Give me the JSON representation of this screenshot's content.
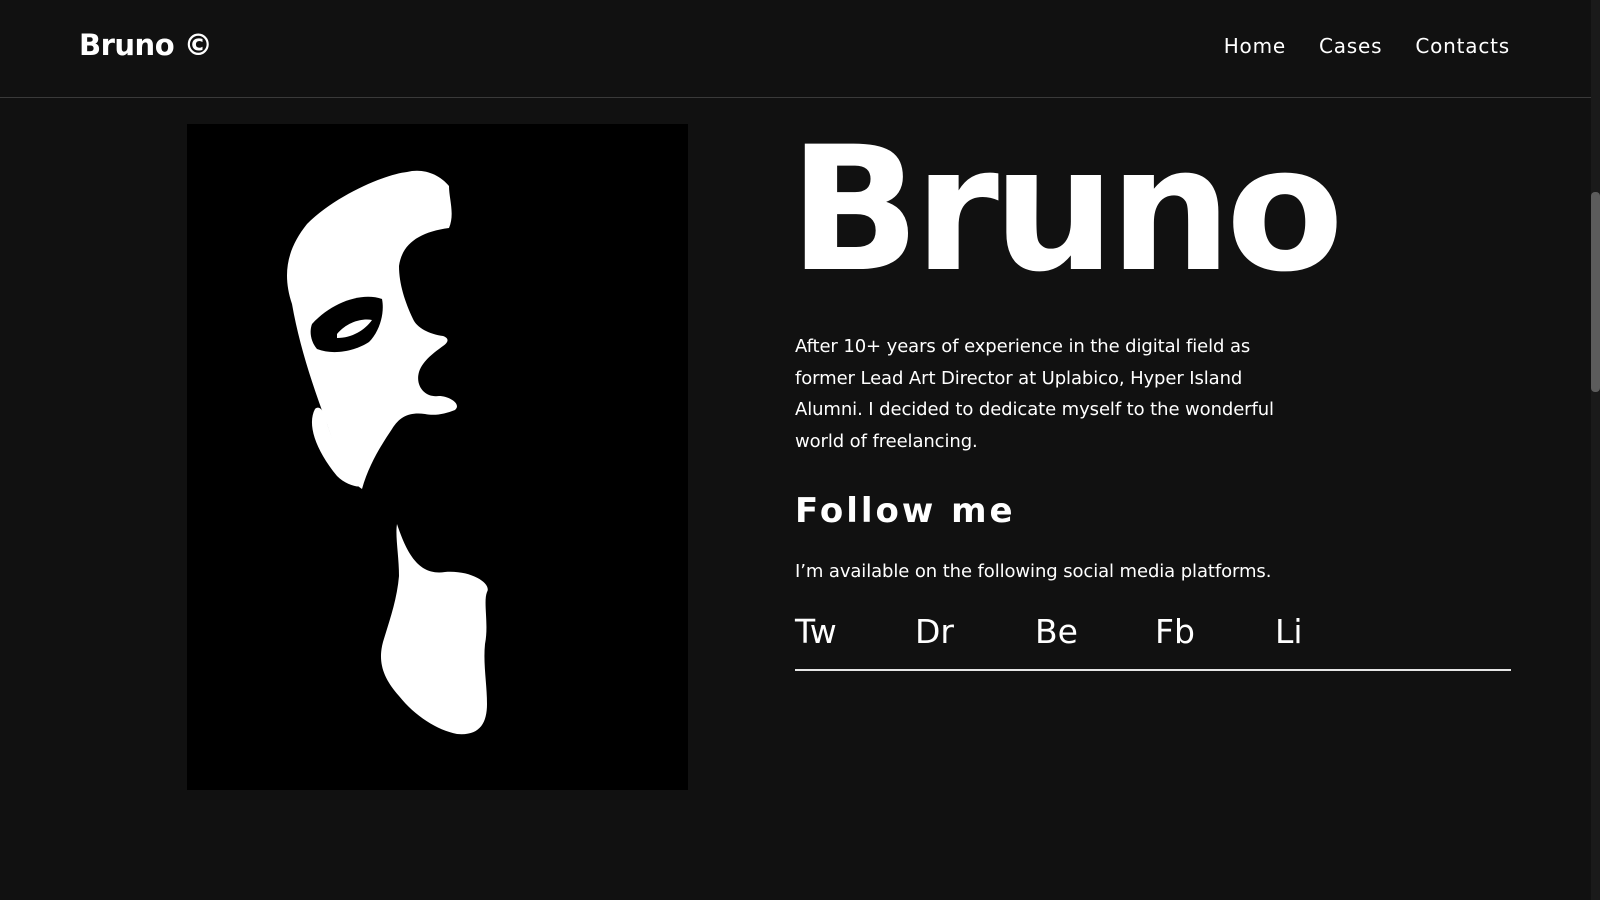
{
  "header": {
    "brand": "Bruno ©",
    "nav": [
      {
        "label": "Home"
      },
      {
        "label": "Cases"
      },
      {
        "label": "Contacts"
      }
    ]
  },
  "portrait": {
    "icon": "portrait-image"
  },
  "main": {
    "hero_title": "Bruno",
    "bio": "After 10+ years of experience in the digital field as former Lead Art Director at Uplabico, Hyper Island Alumni. I decided to dedicate myself to the wonderful world of freelancing.",
    "follow_heading": "Follow me",
    "available_text": "I’m available on the following social media platforms.",
    "social": [
      {
        "label": "Tw"
      },
      {
        "label": "Dr"
      },
      {
        "label": "Be"
      },
      {
        "label": "Fb"
      },
      {
        "label": "Li"
      }
    ]
  },
  "colors": {
    "background": "#111111",
    "text": "#ffffff",
    "portrait_bg": "#000000",
    "divider": "#3a3a3a"
  }
}
